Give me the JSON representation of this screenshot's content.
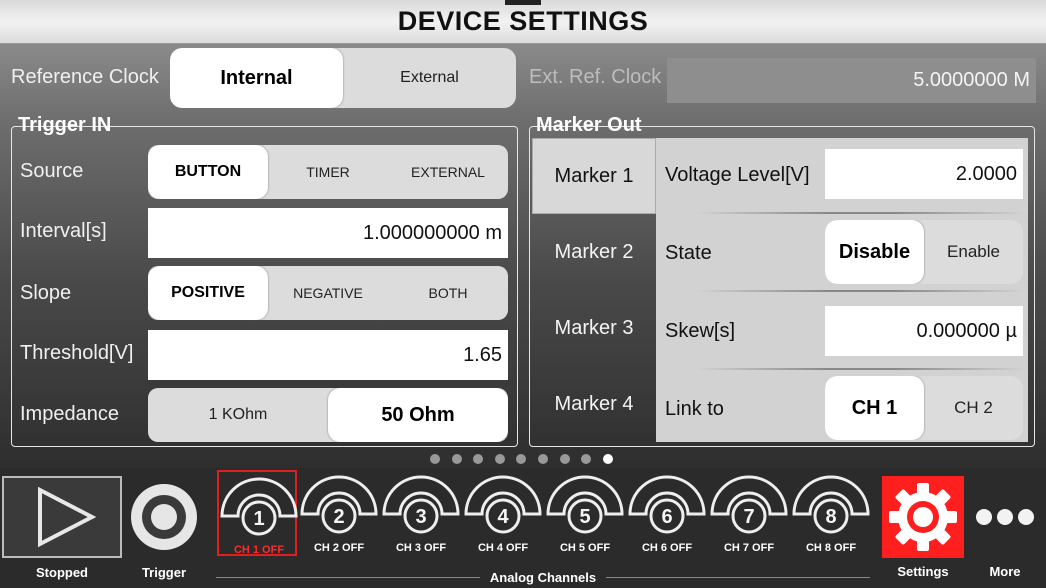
{
  "header": {
    "title": "DEVICE SETTINGS"
  },
  "reference_clock": {
    "label": "Reference Clock",
    "options": [
      "Internal",
      "External"
    ],
    "selected": "Internal",
    "ext_label": "Ext. Ref. Clock",
    "ext_value": "5.0000000 M"
  },
  "trigger_in": {
    "title": "Trigger IN",
    "source": {
      "label": "Source",
      "options": [
        "BUTTON",
        "TIMER",
        "EXTERNAL"
      ],
      "selected": "BUTTON"
    },
    "interval": {
      "label": "Interval[s]",
      "value": "1.000000000 m"
    },
    "slope": {
      "label": "Slope",
      "options": [
        "POSITIVE",
        "NEGATIVE",
        "BOTH"
      ],
      "selected": "POSITIVE"
    },
    "threshold": {
      "label": "Threshold[V]",
      "value": "1.65"
    },
    "impedance": {
      "label": "Impedance",
      "options": [
        "1 KOhm",
        "50 Ohm"
      ],
      "selected": "50 Ohm"
    }
  },
  "marker_out": {
    "title": "Marker Out",
    "markers": [
      "Marker 1",
      "Marker 2",
      "Marker 3",
      "Marker 4"
    ],
    "selected": "Marker 1",
    "voltage": {
      "label": "Voltage Level[V]",
      "value": "2.0000"
    },
    "state": {
      "label": "State",
      "options": [
        "Disable",
        "Enable"
      ],
      "selected": "Disable"
    },
    "skew": {
      "label": "Skew[s]",
      "value": "0.000000 µ"
    },
    "link": {
      "label": "Link to",
      "options": [
        "CH 1",
        "CH 2"
      ],
      "selected": "CH 1"
    }
  },
  "pager": {
    "count": 9,
    "active_index": 8
  },
  "bottom": {
    "stopped_label": "Stopped",
    "trigger_label": "Trigger",
    "analog_label": "Analog Channels",
    "settings_label": "Settings",
    "more_label": "More",
    "channels": [
      {
        "num": "1",
        "label": "CH 1 OFF"
      },
      {
        "num": "2",
        "label": "CH 2 OFF"
      },
      {
        "num": "3",
        "label": "CH 3 OFF"
      },
      {
        "num": "4",
        "label": "CH 4 OFF"
      },
      {
        "num": "5",
        "label": "CH 5 OFF"
      },
      {
        "num": "6",
        "label": "CH 6 OFF"
      },
      {
        "num": "7",
        "label": "CH 7 OFF"
      },
      {
        "num": "8",
        "label": "CH 8 OFF"
      }
    ],
    "selected_channel": "1"
  },
  "colors": {
    "accent_red": "#ff1f1f",
    "selected_channel_border": "#e02020"
  }
}
